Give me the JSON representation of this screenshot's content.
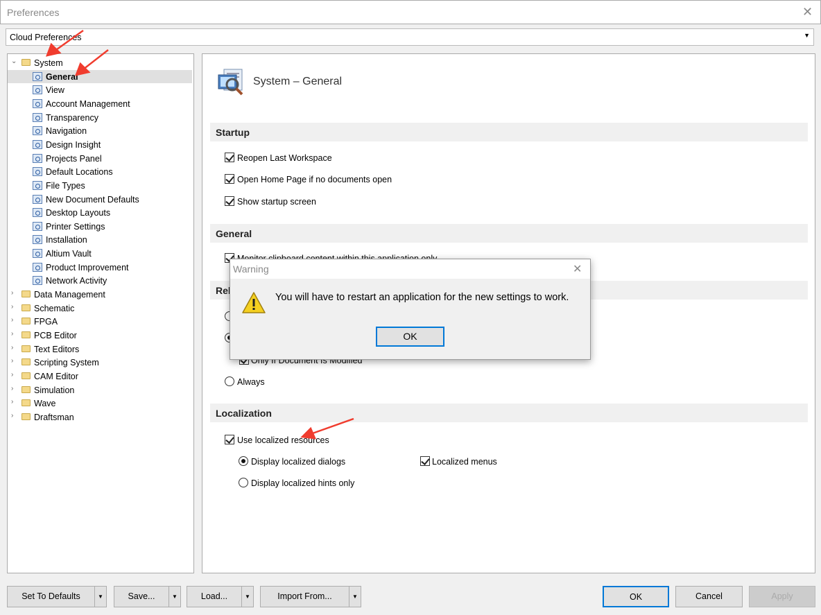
{
  "window": {
    "title": "Preferences",
    "close": "✕"
  },
  "dropdown": {
    "value": "Cloud Preferences",
    "chevron": "▼"
  },
  "tree": [
    {
      "label": "System",
      "level": 0,
      "expanded": true
    },
    {
      "label": "General",
      "level": 1,
      "selected": true
    },
    {
      "label": "View",
      "level": 1
    },
    {
      "label": "Account Management",
      "level": 1
    },
    {
      "label": "Transparency",
      "level": 1
    },
    {
      "label": "Navigation",
      "level": 1
    },
    {
      "label": "Design Insight",
      "level": 1
    },
    {
      "label": "Projects Panel",
      "level": 1
    },
    {
      "label": "Default Locations",
      "level": 1
    },
    {
      "label": "File Types",
      "level": 1
    },
    {
      "label": "New Document Defaults",
      "level": 1
    },
    {
      "label": "Desktop Layouts",
      "level": 1
    },
    {
      "label": "Printer Settings",
      "level": 1
    },
    {
      "label": "Installation",
      "level": 1
    },
    {
      "label": "Altium Vault",
      "level": 1
    },
    {
      "label": "Product Improvement",
      "level": 1
    },
    {
      "label": "Network Activity",
      "level": 1
    },
    {
      "label": "Data Management",
      "level": 0
    },
    {
      "label": "Schematic",
      "level": 0
    },
    {
      "label": "FPGA",
      "level": 0
    },
    {
      "label": "PCB Editor",
      "level": 0
    },
    {
      "label": "Text Editors",
      "level": 0
    },
    {
      "label": "Scripting System",
      "level": 0
    },
    {
      "label": "CAM Editor",
      "level": 0
    },
    {
      "label": "Simulation",
      "level": 0
    },
    {
      "label": "Wave",
      "level": 0
    },
    {
      "label": "Draftsman",
      "level": 0
    }
  ],
  "main": {
    "title": "System – General",
    "startup": {
      "heading": "Startup",
      "reopen": "Reopen Last Workspace",
      "home": "Open Home Page if no documents open",
      "splash": "Show startup screen"
    },
    "general": {
      "heading": "General",
      "monitor": "Monitor clipboard content within this application only"
    },
    "reload": {
      "heading": "Rel",
      "modified": "Only If Document Is Modified",
      "always": "Always"
    },
    "localization": {
      "heading": "Localization",
      "use": "Use localized resources",
      "dialogs": "Display localized dialogs",
      "menus": "Localized menus",
      "hints": "Display localized hints only"
    }
  },
  "buttons": {
    "defaults": "Set To Defaults",
    "save": "Save...",
    "load": "Load...",
    "import": "Import From...",
    "ok": "OK",
    "cancel": "Cancel",
    "apply": "Apply",
    "split": "▼"
  },
  "dialog": {
    "title": "Warning",
    "close": "✕",
    "message": "You will have to restart an application for the new settings to work.",
    "ok": "OK",
    "icon": "warning-icon"
  },
  "colors": {
    "accent": "#0078d7",
    "annotation": "#f03c2e"
  }
}
